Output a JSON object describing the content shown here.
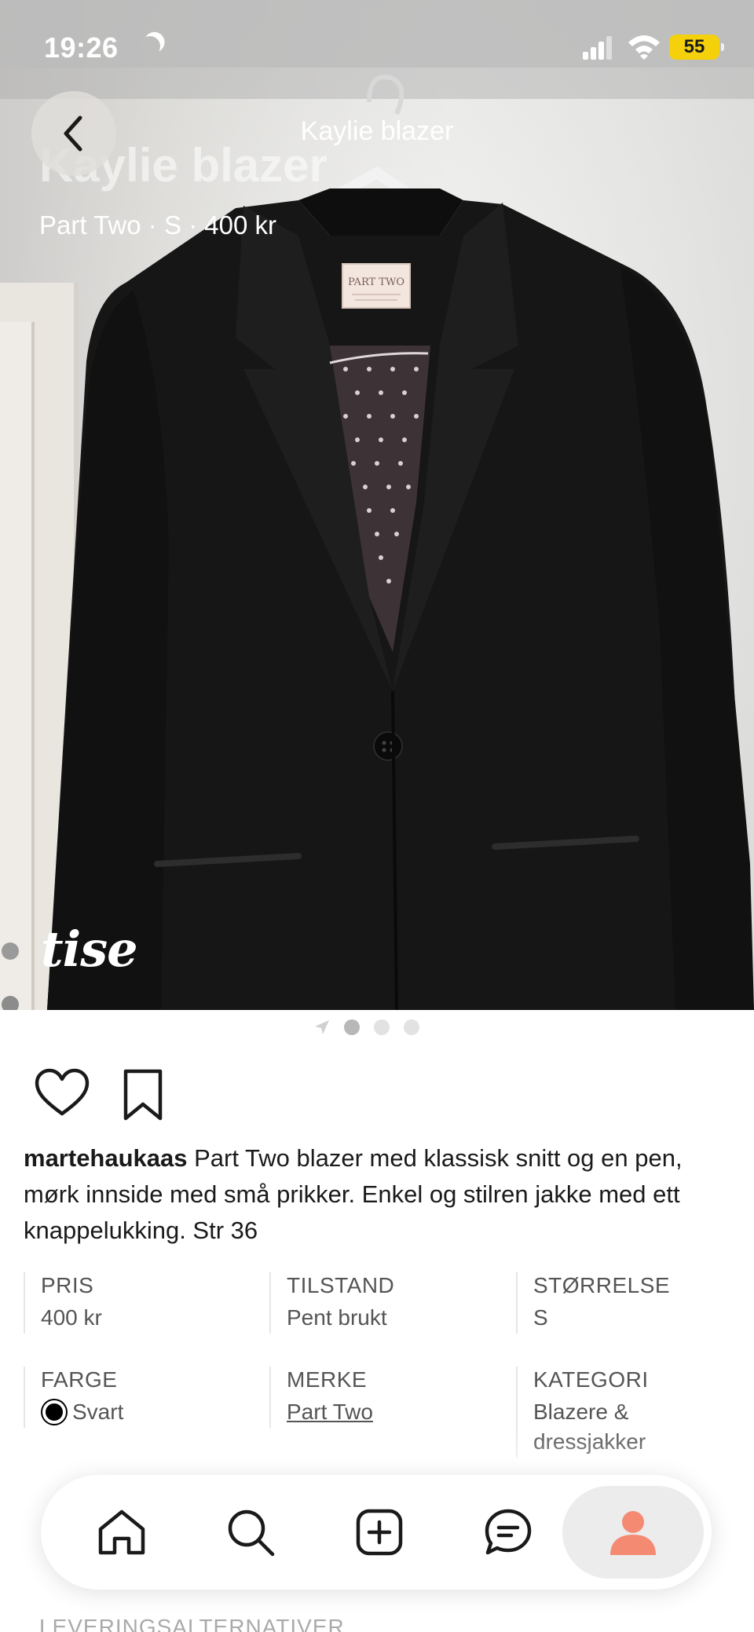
{
  "status_bar": {
    "time": "19:26",
    "battery": "55"
  },
  "header": {
    "title": "Kaylie blazer",
    "ghost_title": "Kaylie blazer",
    "subtitle": "Part Two · S · 400 kr"
  },
  "photo": {
    "watermark": "tise",
    "label_brand": "PART TWO",
    "page_count": 3,
    "active_page": 1
  },
  "post": {
    "username": "martehaukaas",
    "description": " Part Two blazer med klassisk snitt og en pen, mørk innside med små prikker. Enkel og stilren jakke med ett knappelukking. Str 36"
  },
  "attributes": {
    "price": {
      "label": "PRIS",
      "value": "400 kr"
    },
    "condition": {
      "label": "TILSTAND",
      "value": "Pent brukt"
    },
    "size": {
      "label": "STØRRELSE",
      "value": "S"
    },
    "color": {
      "label": "FARGE",
      "value": "Svart",
      "swatch": "#000000"
    },
    "brand": {
      "label": "MERKE",
      "value": "Part Two"
    },
    "category": {
      "label": "KATEGORI",
      "value_line1": "Blazere &",
      "value_line2": "dressjakker"
    }
  },
  "delivery": {
    "label": "LEVERINGSALTERNATIVER"
  },
  "tabbar": {
    "items": [
      "home-icon",
      "search-icon",
      "add-icon",
      "messages-icon",
      "profile-icon"
    ],
    "active": "profile-icon",
    "accent": "#f58a73"
  }
}
